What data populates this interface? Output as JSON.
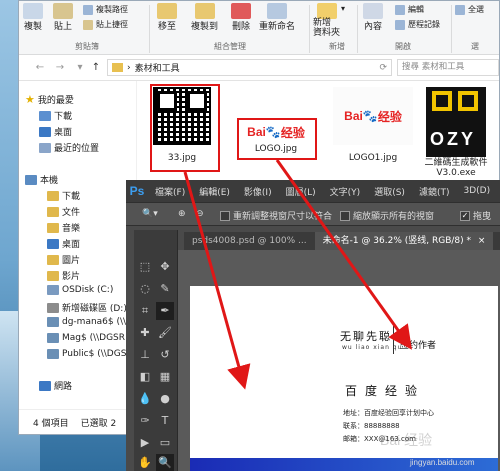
{
  "ribbon": {
    "copy": "複製",
    "paste": "貼上",
    "copy_path": "複製路徑",
    "paste_shortcut": "貼上捷徑",
    "move_to": "移至",
    "copy_to": "複製到",
    "delete": "刪除",
    "rename": "重新命名",
    "new_folder": "新增\n資料夾",
    "properties": "內容",
    "edit": "編輯",
    "history": "歷程記錄",
    "select_all": "全選",
    "group_clipboard": "剪貼簿",
    "group_organize": "組合管理",
    "group_new": "新增",
    "group_open": "開啟",
    "group_select": "選"
  },
  "address": {
    "path": "素材和工具",
    "search_placeholder": "搜尋 素材和工具"
  },
  "nav": {
    "favorites": "我的最愛",
    "downloads": "下載",
    "desktop": "桌面",
    "recent": "最近的位置",
    "this_pc": "本機",
    "items": [
      "下載",
      "文件",
      "音樂",
      "桌面",
      "圖片",
      "影片"
    ],
    "osdisk": "OSDisk (C:)",
    "newvol": "新增磁碟區 (D:)",
    "net1": "dg-mana6$ (\\\\",
    "net2": "Mag$ (\\\\DGSR",
    "net3": "Public$ (\\\\DGSR",
    "network": "網路"
  },
  "files": [
    {
      "name": "33.jpg"
    },
    {
      "name": "LOGO.jpg"
    },
    {
      "name": "LOGO1.jpg"
    },
    {
      "name": "二維碼生成軟件\nV3.0.exe"
    }
  ],
  "logo": {
    "bai": "Bai",
    "paw": "du",
    "jy": "经验"
  },
  "status": {
    "count": "4 個項目",
    "selected": "已選取 2"
  },
  "ps": {
    "logo": "Ps",
    "menus": [
      "檔案(F)",
      "編輯(E)",
      "影像(I)",
      "圖層(L)",
      "文字(Y)",
      "選取(S)",
      "濾鏡(T)",
      "3D(D)"
    ],
    "opt_resize": "重新調整視窗尺寸以符合",
    "opt_zoom_all": "縮放顯示所有的視窗",
    "opt_scrubby": "拖曳",
    "tabs": [
      "psds4008.psd @ 100% ...",
      "未命名-1 @ 36.2% (竖线, RGB/8) *"
    ],
    "close": "×",
    "more": "»"
  },
  "card": {
    "name": "无聊先聪",
    "pinyin": "wu liao xian qu",
    "title": "签约作者",
    "company": "百度经验",
    "address": "地址：百度经验回享计划中心",
    "phone": "联系：88888888",
    "email": "邮箱：XXX@163.com"
  },
  "watermark": "jingyan.baidu.com",
  "watermark2": "Bai 经验"
}
